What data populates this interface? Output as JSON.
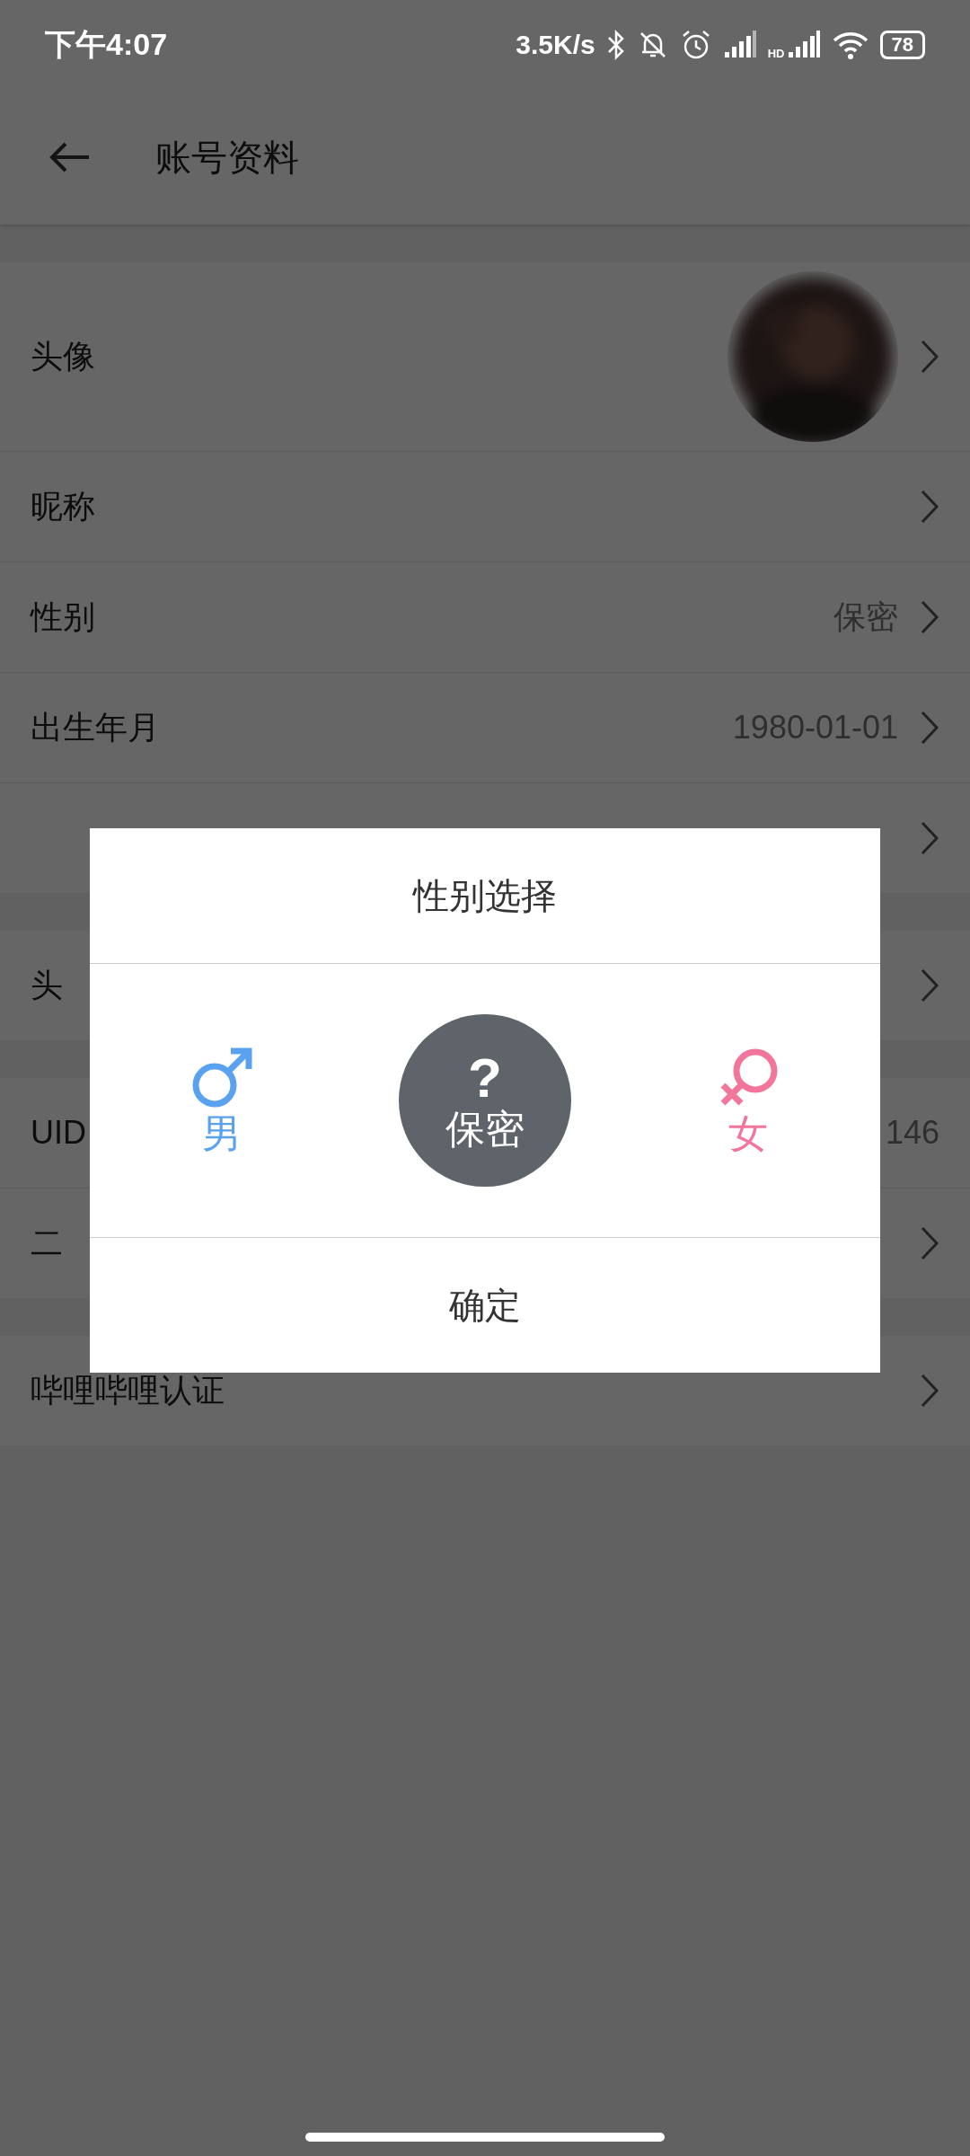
{
  "status_bar": {
    "time": "下午4:07",
    "speed": "3.5K/s",
    "hd": "HD",
    "battery": "78"
  },
  "header": {
    "title": "账号资料"
  },
  "sections": [
    {
      "rows": [
        {
          "kind": "avatar",
          "label": "头像",
          "chevron": true
        },
        {
          "kind": "plain",
          "label": "昵称",
          "chevron": true
        },
        {
          "kind": "plain",
          "label": "性别",
          "value": "保密",
          "chevron": true
        },
        {
          "kind": "plain",
          "label": "出生年月",
          "value": "1980-01-01",
          "chevron": true
        },
        {
          "kind": "plain",
          "chevron": true
        }
      ]
    },
    {
      "rows": [
        {
          "kind": "plain",
          "label": "头",
          "chevron": true
        }
      ]
    },
    {
      "rows": [
        {
          "kind": "plain",
          "label": "UID",
          "value": "146",
          "chevron": false
        },
        {
          "kind": "plain",
          "label": "二",
          "chevron": true
        }
      ]
    },
    {
      "rows": [
        {
          "kind": "plain",
          "label": "哔哩哔哩认证",
          "chevron": true
        }
      ]
    }
  ],
  "dialog": {
    "title": "性别选择",
    "confirm": "确定",
    "options": [
      {
        "kind": "male",
        "label": "男",
        "selected": false,
        "color": "#5aa2f0"
      },
      {
        "kind": "secret",
        "label": "保密",
        "symbol": "?",
        "selected": true,
        "color": "#5f636a"
      },
      {
        "kind": "female",
        "label": "女",
        "selected": false,
        "color": "#f2759c"
      }
    ]
  }
}
